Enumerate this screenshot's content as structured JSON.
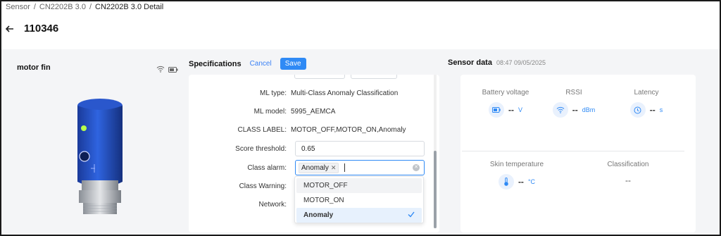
{
  "breadcrumb": {
    "items": [
      "Sensor",
      "CN2202B 3.0",
      "CN2202B 3.0 Detail"
    ],
    "separator": "/"
  },
  "page": {
    "title": "110346"
  },
  "device": {
    "name": "motor fin"
  },
  "specifications": {
    "title": "Specifications",
    "cancel_label": "Cancel",
    "save_label": "Save",
    "rows": {
      "ml_type": {
        "label": "ML type:",
        "value": "Multi-Class Anomaly Classification"
      },
      "ml_model": {
        "label": "ML model:",
        "value": "5995_AEMCA"
      },
      "class_label": {
        "label": "CLASS LABEL:",
        "value": "MOTOR_OFF,MOTOR_ON,Anomaly"
      },
      "score_threshold": {
        "label": "Score threshold:",
        "value": "0.65"
      },
      "class_alarm": {
        "label": "Class alarm:",
        "tag": "Anomaly"
      },
      "class_warning": {
        "label": "Class Warning:"
      },
      "network": {
        "label": "Network:"
      }
    },
    "dropdown_options": [
      "MOTOR_OFF",
      "MOTOR_ON",
      "Anomaly"
    ],
    "dropdown_selected": "Anomaly"
  },
  "sensor_data": {
    "title": "Sensor data",
    "timestamp": "08:47 09/05/2025",
    "metrics": {
      "battery": {
        "label": "Battery voltage",
        "value": "--",
        "unit": "V"
      },
      "rssi": {
        "label": "RSSI",
        "value": "--",
        "unit": "dBm"
      },
      "latency": {
        "label": "Latency",
        "value": "--",
        "unit": "s"
      },
      "skin_temp": {
        "label": "Skin temperature",
        "value": "--",
        "unit": "°C"
      },
      "classification": {
        "label": "Classification",
        "value": "--"
      }
    }
  },
  "colors": {
    "accent": "#2f8af5",
    "device_blue": "#1f4fbf"
  }
}
